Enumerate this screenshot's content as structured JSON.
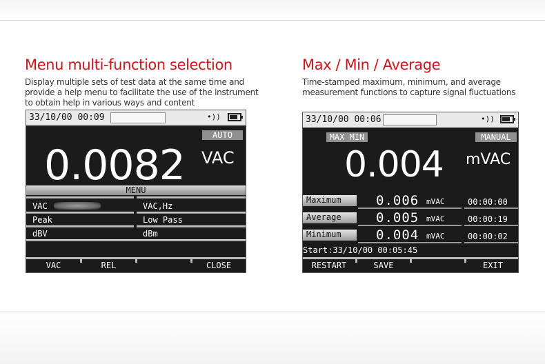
{
  "left_panel": {
    "title": "Menu multi-function selection",
    "description": [
      "Display multiple sets of test data at the same time and",
      "provide a help menu to facilitate the use of the instrument",
      "to obtain help in various ways and content"
    ],
    "screen": {
      "timestamp": "33/10/00 00:09",
      "signal": "•))",
      "range_mode": "AUTO",
      "reading": "0.0082",
      "unit": "VAC",
      "menu_title": "MENU",
      "menu_left": [
        "VAC",
        "Peak",
        "dBV"
      ],
      "menu_right": [
        "VAC,Hz",
        "Low Pass",
        "dBm"
      ],
      "softkeys": [
        "VAC",
        "REL",
        "",
        "CLOSE"
      ]
    }
  },
  "right_panel": {
    "title": "Max / Min / Average",
    "description": [
      "Time-stamped maximum, minimum, and average",
      "measurement functions to capture signal fluctuations"
    ],
    "screen": {
      "timestamp": "33/10/00 00:06",
      "signal": "•))",
      "maxmin_tag": "MAX MIN",
      "range_mode": "MANUAL",
      "reading": "0.004",
      "unit": "mVAC",
      "rows": [
        {
          "label": "Maximum",
          "value": "0.006",
          "unit": "mVAC",
          "time": "00:00:00"
        },
        {
          "label": "Average",
          "value": "0.005",
          "unit": "mVAC",
          "time": "00:00:19"
        },
        {
          "label": "Minimum",
          "value": "0.004",
          "unit": "mVAC",
          "time": "00:00:02"
        }
      ],
      "start_label": "Start:",
      "start_time": "33/10/00 00:05:45",
      "softkeys": [
        "RESTART",
        "SAVE",
        "",
        "EXIT"
      ]
    }
  },
  "colors": {
    "title": "#c8161d",
    "screen_bg": "#1b1b1b"
  }
}
